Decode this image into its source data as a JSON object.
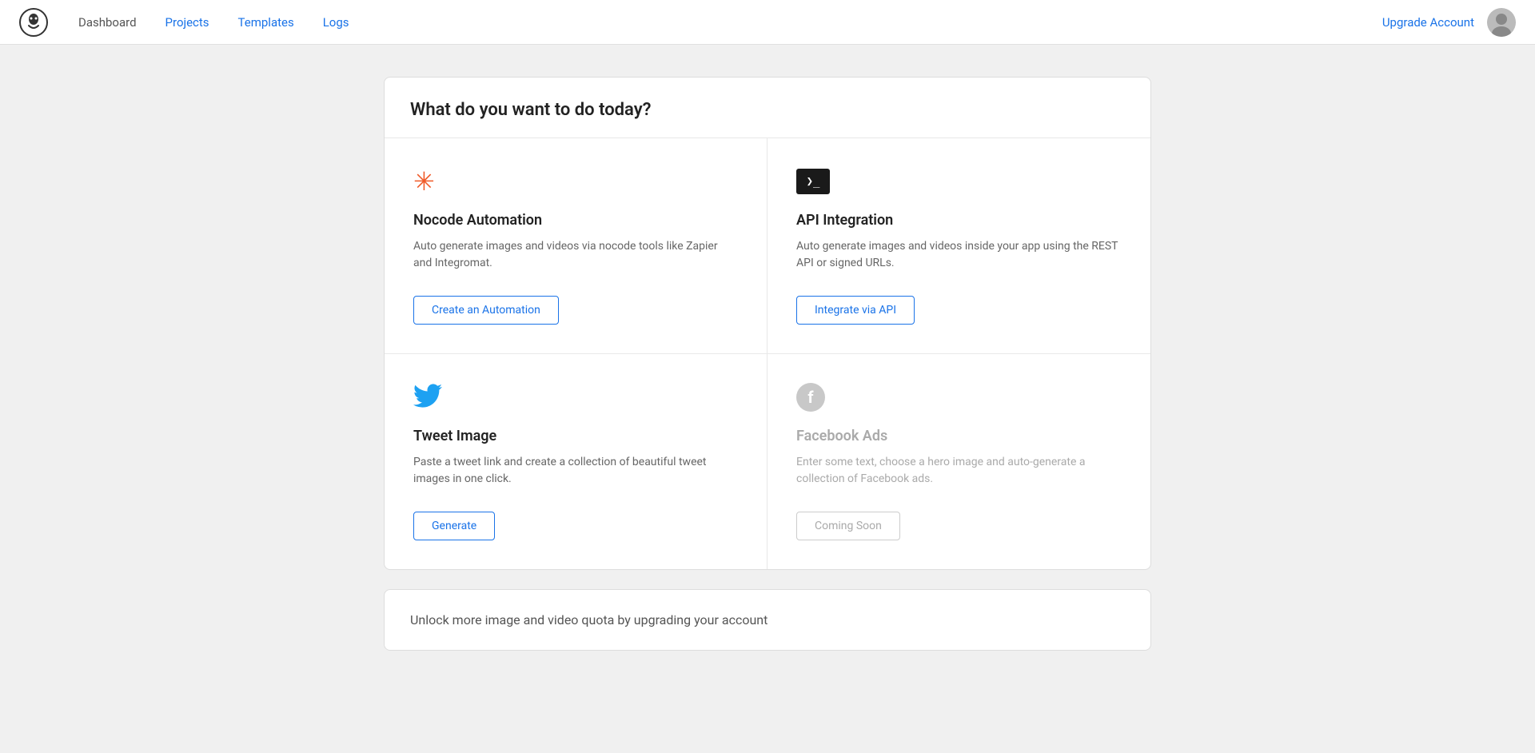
{
  "nav": {
    "logo_alt": "Bannerbear logo",
    "links": [
      {
        "label": "Dashboard",
        "active": false
      },
      {
        "label": "Projects",
        "active": false
      },
      {
        "label": "Templates",
        "active": true
      },
      {
        "label": "Logs",
        "active": false
      }
    ],
    "upgrade_label": "Upgrade Account"
  },
  "main": {
    "card_title": "What do you want to do today?",
    "options": [
      {
        "id": "nocode",
        "icon_type": "nocode",
        "title": "Nocode Automation",
        "desc": "Auto generate images and videos via nocode tools like Zapier and Integromat.",
        "btn_label": "Create an Automation",
        "btn_disabled": false
      },
      {
        "id": "api",
        "icon_type": "terminal",
        "title": "API Integration",
        "desc": "Auto generate images and videos inside your app using the REST API or signed URLs.",
        "btn_label": "Integrate via API",
        "btn_disabled": false
      },
      {
        "id": "tweet",
        "icon_type": "twitter",
        "title": "Tweet Image",
        "desc": "Paste a tweet link and create a collection of beautiful tweet images in one click.",
        "btn_label": "Generate",
        "btn_disabled": false
      },
      {
        "id": "facebook",
        "icon_type": "facebook",
        "title": "Facebook Ads",
        "desc": "Enter some text, choose a hero image and auto-generate a collection of Facebook ads.",
        "btn_label": "Coming Soon",
        "btn_disabled": true
      }
    ],
    "upgrade_text": "Unlock more image and video quota by upgrading your account"
  }
}
